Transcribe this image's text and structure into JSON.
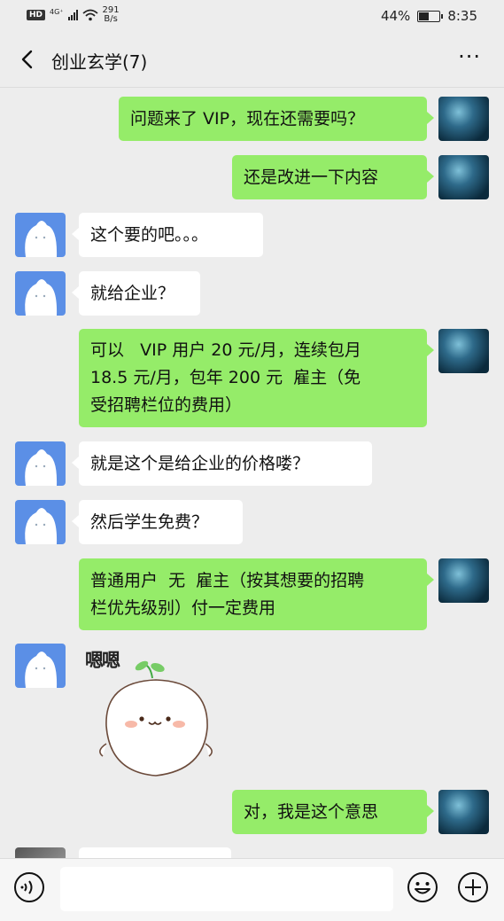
{
  "status_bar": {
    "hd": "HD",
    "network": "4G⁺",
    "speed_value": "291",
    "speed_unit": "B/s",
    "battery": "44%",
    "battery_level": 0.44,
    "time": "8:35"
  },
  "header": {
    "back_icon": "chevron-left-icon",
    "title": "创业玄学(7)",
    "more_icon": "more-dots-icon",
    "more_label": "···"
  },
  "messages": [
    {
      "side": "right",
      "text": "问题来了 VIP，现在还需要吗？"
    },
    {
      "side": "right",
      "text": "还是改进一下内容"
    },
    {
      "side": "left",
      "text": "这个要的吧。。。"
    },
    {
      "side": "left",
      "text": "就给企业？"
    },
    {
      "side": "right",
      "text": "可以   VIP 用户 20 元/月，连续包月\n18.5 元/月，包年 200 元  雇主（免\n受招聘栏位的费用）"
    },
    {
      "side": "left",
      "text": "就是这个是给企业的价格喽？"
    },
    {
      "side": "left",
      "text": "然后学生免费？"
    },
    {
      "side": "right",
      "text": "普通用户  无  雇主（按其想要的招聘\n栏优先级别）付一定费用"
    },
    {
      "side": "left",
      "sticker_text": "嗯嗯"
    },
    {
      "side": "right",
      "text": "对，我是这个意思"
    }
  ],
  "input_bar": {
    "voice_icon": "voice-icon",
    "input_value": "",
    "emoji_icon": "emoji-icon",
    "plus_icon": "plus-circle-icon"
  },
  "colors": {
    "background": "#ededed",
    "sent_bubble": "#95ec69",
    "received_bubble": "#ffffff"
  }
}
